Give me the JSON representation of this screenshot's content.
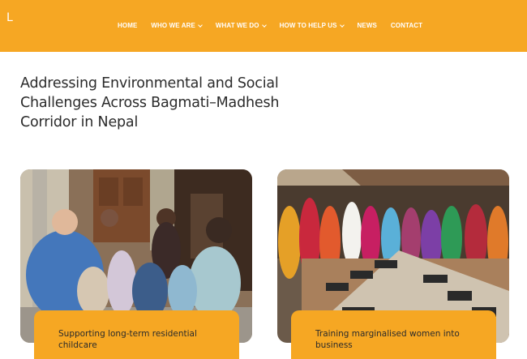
{
  "header": {
    "logo": "L",
    "nav": [
      {
        "label": "HOME",
        "dropdown": false
      },
      {
        "label": "WHO WE ARE",
        "dropdown": true
      },
      {
        "label": "WHAT WE DO",
        "dropdown": true
      },
      {
        "label": "HOW TO HELP US",
        "dropdown": true
      },
      {
        "label": "NEWS",
        "dropdown": false
      },
      {
        "label": "CONTACT",
        "dropdown": false
      }
    ]
  },
  "main": {
    "title": "Addressing Environmental and Social Challenges Across Bagmati–Madhesh Corridor in Nepal",
    "cards": [
      {
        "caption": "Supporting long-term residential childcare"
      },
      {
        "caption": "Training marginalised women into business"
      }
    ]
  },
  "colors": {
    "accent": "#f6a723",
    "text": "#2b2b2b",
    "background": "#ffffff"
  }
}
